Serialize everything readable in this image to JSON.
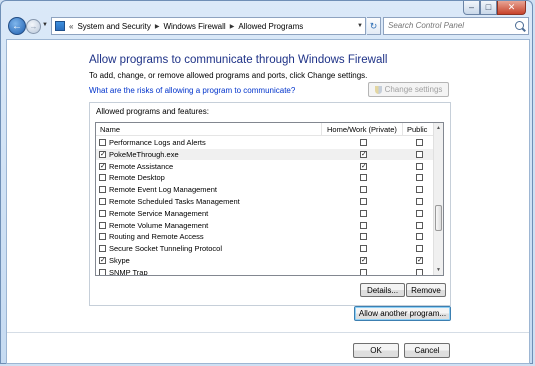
{
  "window": {
    "caption_buttons": {
      "minimize": "–",
      "maximize": "□",
      "close": "✕"
    }
  },
  "nav": {
    "back_glyph": "←",
    "forward_glyph": "→",
    "overflow": "«",
    "breadcrumbs": [
      "System and Security",
      "Windows Firewall",
      "Allowed Programs"
    ],
    "search_placeholder": "Search Control Panel"
  },
  "page": {
    "title": "Allow programs to communicate through Windows Firewall",
    "instructions": "To add, change, or remove allowed programs and ports, click Change settings.",
    "risk_link": "What are the risks of allowing a program to communicate?",
    "change_settings": "Change settings",
    "group_label": "Allowed programs and features:",
    "columns": {
      "name": "Name",
      "home": "Home/Work (Private)",
      "public": "Public"
    },
    "rows": [
      {
        "name": "Performance Logs and Alerts",
        "checked": false,
        "home": false,
        "public": false,
        "selected": false
      },
      {
        "name": "PokeMeThrough.exe",
        "checked": true,
        "home": true,
        "public": false,
        "selected": true
      },
      {
        "name": "Remote Assistance",
        "checked": true,
        "home": true,
        "public": false,
        "selected": false
      },
      {
        "name": "Remote Desktop",
        "checked": false,
        "home": false,
        "public": false,
        "selected": false
      },
      {
        "name": "Remote Event Log Management",
        "checked": false,
        "home": false,
        "public": false,
        "selected": false
      },
      {
        "name": "Remote Scheduled Tasks Management",
        "checked": false,
        "home": false,
        "public": false,
        "selected": false
      },
      {
        "name": "Remote Service Management",
        "checked": false,
        "home": false,
        "public": false,
        "selected": false
      },
      {
        "name": "Remote Volume Management",
        "checked": false,
        "home": false,
        "public": false,
        "selected": false
      },
      {
        "name": "Routing and Remote Access",
        "checked": false,
        "home": false,
        "public": false,
        "selected": false
      },
      {
        "name": "Secure Socket Tunneling Protocol",
        "checked": false,
        "home": false,
        "public": false,
        "selected": false
      },
      {
        "name": "Skype",
        "checked": true,
        "home": true,
        "public": true,
        "selected": false
      },
      {
        "name": "SNMP Trap",
        "checked": false,
        "home": false,
        "public": false,
        "selected": false
      }
    ],
    "details": "Details...",
    "remove": "Remove",
    "allow_another": "Allow another program...",
    "ok": "OK",
    "cancel": "Cancel"
  }
}
